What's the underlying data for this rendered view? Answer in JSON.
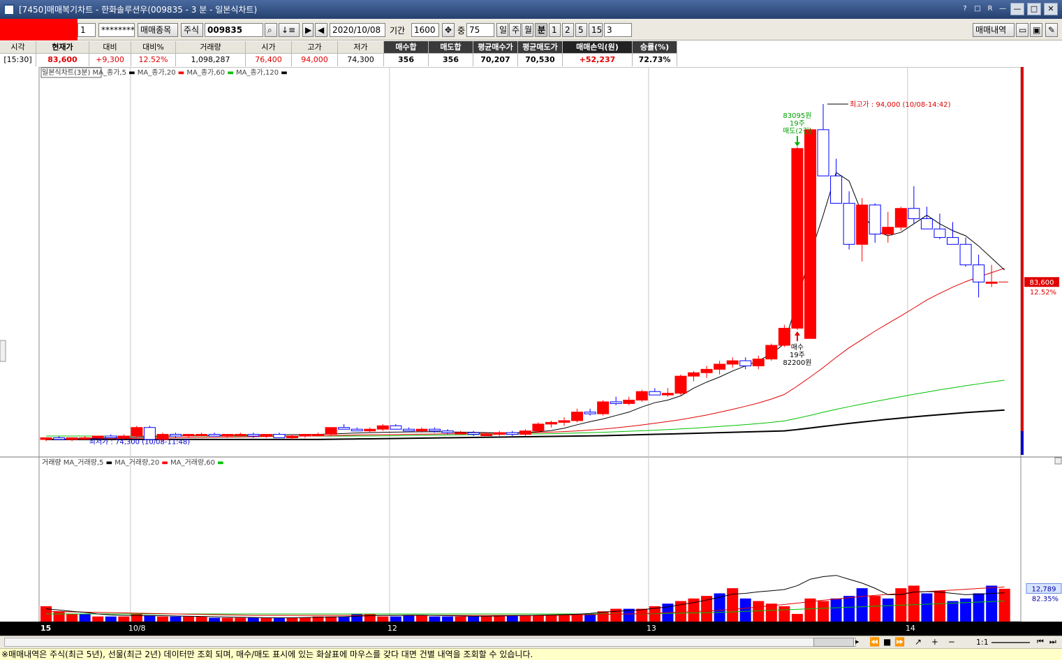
{
  "window": {
    "title": "[7450]매매복기차트 - 한화솔루션우(009835 - 3 분 - 일본식차트)",
    "right_icons": [
      "?",
      "□",
      "R",
      "—",
      "—",
      "□",
      "✕"
    ]
  },
  "toolbar": {
    "account_no": "1",
    "password": "********",
    "trade_item_btn": "매매종목",
    "market": "주식",
    "code": "009835",
    "date": "2020/10/08",
    "period_label": "기간",
    "period_value": "1600",
    "middle_label": "중",
    "middle_value": "75",
    "units": [
      "일",
      "주",
      "월",
      "분",
      "1",
      "2",
      "5",
      "15"
    ],
    "interval": "3",
    "trade_history_btn": "매매내역"
  },
  "info": {
    "headers": [
      "시각",
      "현재가",
      "대비",
      "대비%",
      "거래량",
      "시가",
      "고가",
      "저가",
      "매수합",
      "매도합",
      "평균매수가",
      "평균매도가",
      "매매손익(원)",
      "승률(%)"
    ],
    "values": [
      "[15:30]",
      "83,600",
      "+9,300",
      "12.52%",
      "1,098,287",
      "76,400",
      "94,000",
      "74,300",
      "356",
      "356",
      "70,207",
      "70,530",
      "+52,237",
      "72.73%"
    ]
  },
  "price_legend": {
    "name": "일본식차트(3분)",
    "items": [
      {
        "label": "MA_종가,5",
        "color": "#000000"
      },
      {
        "label": "MA_종가,20",
        "color": "#ff0000"
      },
      {
        "label": "MA_종가,60",
        "color": "#00c000"
      },
      {
        "label": "MA_종가,120",
        "color": "#000000"
      }
    ]
  },
  "volume_legend": {
    "name": "거래량",
    "items": [
      {
        "label": "MA_거래량,5",
        "color": "#000000"
      },
      {
        "label": "MA_거래량,20",
        "color": "#ff0000"
      },
      {
        "label": "MA_거래량,60",
        "color": "#00c000"
      }
    ]
  },
  "annotations": {
    "high": "최고가 : 94,000 (10/08-14:42)",
    "low": "최저가 : 74,300 (10/08-11:48)",
    "sell_lines": [
      "83095원",
      "19주",
      "매도(2건)"
    ],
    "buy_lines": [
      "매수",
      "19주",
      "82200원"
    ],
    "price_tag": "83,600",
    "price_pct": "12.52%",
    "vol_tag": "12,789",
    "vol_pct": "82.35%"
  },
  "x_labels": [
    "10/8",
    "12",
    "13",
    "14",
    "15"
  ],
  "status": "※매매내역은 주식(최근 5년), 선물(최근 2년) 데이터만 조회 되며, 매수/매도 표시에 있는 화살표에 마우스를 갖다 대면 건별 내역을 조회할 수 있습니다.",
  "scroll": {
    "zoom_label": "1:1"
  },
  "chart_data": {
    "type": "candlestick",
    "colors": {
      "up": "#ff0000",
      "down": "#0000ff"
    },
    "ylim": [
      73500,
      96000
    ],
    "candles": [
      {
        "o": 74400,
        "h": 74500,
        "l": 74300,
        "c": 74500
      },
      {
        "o": 74500,
        "h": 74600,
        "l": 74400,
        "c": 74400
      },
      {
        "o": 74400,
        "h": 74500,
        "l": 74300,
        "c": 74500
      },
      {
        "o": 74500,
        "h": 74600,
        "l": 74400,
        "c": 74500
      },
      {
        "o": 74500,
        "h": 74600,
        "l": 74400,
        "c": 74600
      },
      {
        "o": 74600,
        "h": 74700,
        "l": 74500,
        "c": 74500
      },
      {
        "o": 74500,
        "h": 74700,
        "l": 74400,
        "c": 74600
      },
      {
        "o": 74600,
        "h": 75200,
        "l": 74500,
        "c": 75100
      },
      {
        "o": 75100,
        "h": 75200,
        "l": 74400,
        "c": 74400
      },
      {
        "o": 74400,
        "h": 74800,
        "l": 74300,
        "c": 74700
      },
      {
        "o": 74700,
        "h": 74800,
        "l": 74500,
        "c": 74600
      },
      {
        "o": 74600,
        "h": 74700,
        "l": 74500,
        "c": 74700
      },
      {
        "o": 74700,
        "h": 74800,
        "l": 74600,
        "c": 74700
      },
      {
        "o": 74700,
        "h": 74800,
        "l": 74600,
        "c": 74600
      },
      {
        "o": 74600,
        "h": 74700,
        "l": 74500,
        "c": 74700
      },
      {
        "o": 74700,
        "h": 74800,
        "l": 74600,
        "c": 74700
      },
      {
        "o": 74700,
        "h": 74800,
        "l": 74500,
        "c": 74600
      },
      {
        "o": 74600,
        "h": 74700,
        "l": 74500,
        "c": 74700
      },
      {
        "o": 74700,
        "h": 74800,
        "l": 74500,
        "c": 74500
      },
      {
        "o": 74500,
        "h": 74700,
        "l": 74400,
        "c": 74600
      },
      {
        "o": 74600,
        "h": 74700,
        "l": 74500,
        "c": 74700
      },
      {
        "o": 74700,
        "h": 74800,
        "l": 74600,
        "c": 74700
      },
      {
        "o": 74700,
        "h": 74800,
        "l": 74600,
        "c": 75100
      },
      {
        "o": 75100,
        "h": 75300,
        "l": 75000,
        "c": 75000
      },
      {
        "o": 75000,
        "h": 75100,
        "l": 74900,
        "c": 74900
      },
      {
        "o": 74900,
        "h": 75100,
        "l": 74800,
        "c": 75000
      },
      {
        "o": 75000,
        "h": 75300,
        "l": 74900,
        "c": 75200
      },
      {
        "o": 75200,
        "h": 75300,
        "l": 75000,
        "c": 75000
      },
      {
        "o": 75000,
        "h": 75100,
        "l": 74900,
        "c": 74900
      },
      {
        "o": 74900,
        "h": 75100,
        "l": 74800,
        "c": 75000
      },
      {
        "o": 75000,
        "h": 75100,
        "l": 74800,
        "c": 74900
      },
      {
        "o": 74900,
        "h": 75000,
        "l": 74700,
        "c": 74800
      },
      {
        "o": 74800,
        "h": 74900,
        "l": 74700,
        "c": 74800
      },
      {
        "o": 74800,
        "h": 74900,
        "l": 74600,
        "c": 74700
      },
      {
        "o": 74700,
        "h": 74800,
        "l": 74600,
        "c": 74700
      },
      {
        "o": 74700,
        "h": 74900,
        "l": 74600,
        "c": 74800
      },
      {
        "o": 74800,
        "h": 74900,
        "l": 74600,
        "c": 74700
      },
      {
        "o": 74700,
        "h": 75000,
        "l": 74600,
        "c": 74900
      },
      {
        "o": 74900,
        "h": 75400,
        "l": 74800,
        "c": 75300
      },
      {
        "o": 75300,
        "h": 75500,
        "l": 75100,
        "c": 75400
      },
      {
        "o": 75400,
        "h": 75700,
        "l": 75200,
        "c": 75500
      },
      {
        "o": 75500,
        "h": 76200,
        "l": 75400,
        "c": 76000
      },
      {
        "o": 76000,
        "h": 76200,
        "l": 75800,
        "c": 75900
      },
      {
        "o": 75900,
        "h": 76700,
        "l": 75800,
        "c": 76600
      },
      {
        "o": 76600,
        "h": 76900,
        "l": 76400,
        "c": 76500
      },
      {
        "o": 76500,
        "h": 76900,
        "l": 76400,
        "c": 76700
      },
      {
        "o": 76700,
        "h": 77300,
        "l": 76600,
        "c": 77200
      },
      {
        "o": 77200,
        "h": 77400,
        "l": 77000,
        "c": 77000
      },
      {
        "o": 77000,
        "h": 77400,
        "l": 76900,
        "c": 77100
      },
      {
        "o": 77100,
        "h": 78200,
        "l": 77000,
        "c": 78100
      },
      {
        "o": 78100,
        "h": 78400,
        "l": 77800,
        "c": 78300
      },
      {
        "o": 78300,
        "h": 78700,
        "l": 78000,
        "c": 78500
      },
      {
        "o": 78500,
        "h": 79000,
        "l": 78200,
        "c": 78800
      },
      {
        "o": 78800,
        "h": 79200,
        "l": 78600,
        "c": 79000
      },
      {
        "o": 79000,
        "h": 79200,
        "l": 78500,
        "c": 78700
      },
      {
        "o": 78700,
        "h": 79300,
        "l": 78500,
        "c": 79100
      },
      {
        "o": 79100,
        "h": 80000,
        "l": 79000,
        "c": 79900
      },
      {
        "o": 79900,
        "h": 81100,
        "l": 79800,
        "c": 80900
      },
      {
        "o": 80900,
        "h": 91500,
        "l": 80800,
        "c": 91400
      },
      {
        "o": 80300,
        "h": 92600,
        "l": 80300,
        "c": 92500
      },
      {
        "o": 92500,
        "h": 94000,
        "l": 89800,
        "c": 89800
      },
      {
        "o": 89800,
        "h": 90800,
        "l": 88300,
        "c": 88200
      },
      {
        "o": 88200,
        "h": 88900,
        "l": 85500,
        "c": 85800
      },
      {
        "o": 85800,
        "h": 88500,
        "l": 84800,
        "c": 88100
      },
      {
        "o": 88100,
        "h": 88200,
        "l": 85900,
        "c": 86400
      },
      {
        "o": 86400,
        "h": 87700,
        "l": 85900,
        "c": 86800
      },
      {
        "o": 86800,
        "h": 88000,
        "l": 86600,
        "c": 87900
      },
      {
        "o": 87900,
        "h": 89200,
        "l": 87000,
        "c": 87300
      },
      {
        "o": 87300,
        "h": 88000,
        "l": 86700,
        "c": 86700
      },
      {
        "o": 86700,
        "h": 87600,
        "l": 86100,
        "c": 86200
      },
      {
        "o": 86200,
        "h": 87100,
        "l": 85800,
        "c": 85800
      },
      {
        "o": 85800,
        "h": 86200,
        "l": 84500,
        "c": 84600
      },
      {
        "o": 84600,
        "h": 85200,
        "l": 82700,
        "c": 83600
      },
      {
        "o": 83600,
        "h": 84600,
        "l": 83300,
        "c": 83600
      }
    ],
    "ma5": [
      74400,
      74420,
      74440,
      74460,
      74480,
      74500,
      74520,
      74540,
      74560,
      74580,
      74600,
      74610,
      74620,
      74630,
      74640,
      74650,
      74660,
      74670,
      74680,
      74680,
      74690,
      74700,
      74720,
      74750,
      74780,
      74800,
      74820,
      74830,
      74840,
      74850,
      74850,
      74840,
      74830,
      74820,
      74800,
      74780,
      74790,
      74810,
      74850,
      74920,
      75060,
      75260,
      75440,
      75600,
      75800,
      76000,
      76300,
      76550,
      76700,
      76950,
      77400,
      77750,
      78050,
      78400,
      78700,
      79000,
      79400,
      80000,
      82500,
      85200,
      87500,
      90000,
      89500,
      87600,
      86600,
      86300,
      86500,
      87000,
      87500,
      87000,
      86600,
      86300,
      85700,
      85000,
      84300
    ],
    "ma20": [
      74400,
      74410,
      74420,
      74430,
      74440,
      74450,
      74460,
      74470,
      74480,
      74490,
      74500,
      74510,
      74520,
      74530,
      74540,
      74550,
      74560,
      74570,
      74580,
      74590,
      74600,
      74610,
      74620,
      74640,
      74660,
      74670,
      74680,
      74690,
      74700,
      74710,
      74720,
      74730,
      74740,
      74750,
      74760,
      74770,
      74780,
      74790,
      74810,
      74830,
      74860,
      74900,
      74950,
      75010,
      75080,
      75160,
      75250,
      75350,
      75450,
      75560,
      75690,
      75830,
      75990,
      76160,
      76340,
      76530,
      76760,
      77030,
      77520,
      78050,
      78600,
      79200,
      79760,
      80240,
      80730,
      81180,
      81620,
      82080,
      82550,
      82940,
      83300,
      83620,
      83900,
      84150,
      84400
    ],
    "ma60": [
      74600,
      74600,
      74600,
      74600,
      74600,
      74600,
      74600,
      74600,
      74600,
      74600,
      74600,
      74600,
      74600,
      74600,
      74600,
      74600,
      74600,
      74600,
      74600,
      74600,
      74600,
      74600,
      74600,
      74600,
      74600,
      74600,
      74610,
      74620,
      74630,
      74640,
      74650,
      74660,
      74670,
      74680,
      74690,
      74700,
      74710,
      74720,
      74730,
      74740,
      74760,
      74780,
      74800,
      74820,
      74850,
      74880,
      74910,
      74940,
      74980,
      75020,
      75060,
      75110,
      75160,
      75210,
      75270,
      75330,
      75400,
      75480,
      75640,
      75810,
      75990,
      76160,
      76320,
      76470,
      76620,
      76760,
      76900,
      77040,
      77170,
      77300,
      77420,
      77540,
      77650,
      77760,
      77860
    ],
    "ma120": [
      74400,
      74400,
      74400,
      74400,
      74400,
      74400,
      74400,
      74400,
      74400,
      74400,
      74400,
      74400,
      74400,
      74400,
      74400,
      74400,
      74400,
      74400,
      74400,
      74400,
      74400,
      74400,
      74410,
      74420,
      74430,
      74440,
      74450,
      74460,
      74470,
      74480,
      74490,
      74500,
      74510,
      74520,
      74530,
      74540,
      74550,
      74560,
      74570,
      74580,
      74590,
      74600,
      74610,
      74620,
      74640,
      74660,
      74680,
      74700,
      74720,
      74740,
      74760,
      74780,
      74800,
      74820,
      74840,
      74860,
      74880,
      74900,
      74980,
      75070,
      75160,
      75250,
      75340,
      75420,
      75500,
      75580,
      75650,
      75720,
      75790,
      75850,
      75910,
      75970,
      76020,
      76070,
      76120
    ],
    "volume": [
      6000,
      4000,
      3000,
      3000,
      2000,
      2000,
      2000,
      3000,
      2500,
      2000,
      2000,
      2000,
      2000,
      1500,
      1500,
      1500,
      1500,
      1500,
      1500,
      1500,
      1500,
      2000,
      2000,
      2000,
      3000,
      3000,
      2000,
      2000,
      2500,
      2500,
      2000,
      2000,
      2000,
      2000,
      2000,
      2500,
      2500,
      2500,
      2500,
      2500,
      2500,
      3000,
      3000,
      4000,
      5000,
      5000,
      5000,
      6000,
      7000,
      8000,
      9000,
      10000,
      11000,
      13000,
      9000,
      8000,
      7000,
      6000,
      3000,
      9000,
      8000,
      9000,
      10000,
      13000,
      10000,
      9000,
      13000,
      14000,
      11000,
      12000,
      8000,
      9000,
      11000,
      14000,
      12789
    ],
    "vol_up": [
      1,
      1,
      1,
      0,
      1,
      0,
      1,
      1,
      0,
      1,
      0,
      1,
      1,
      0,
      1,
      1,
      0,
      1,
      0,
      1,
      1,
      1,
      1,
      0,
      0,
      1,
      1,
      0,
      0,
      1,
      0,
      0,
      1,
      0,
      1,
      1,
      0,
      1,
      1,
      1,
      1,
      1,
      0,
      1,
      1,
      0,
      1,
      1,
      0,
      1,
      1,
      1,
      0,
      1,
      0,
      1,
      1,
      1,
      1,
      1,
      1,
      0,
      0,
      0,
      1,
      0,
      1,
      1,
      0,
      1,
      0,
      0,
      0,
      0,
      1
    ],
    "vol_ma5": [
      5000,
      4500,
      4000,
      3600,
      3000,
      2600,
      2400,
      2400,
      2300,
      2300,
      2200,
      2100,
      2000,
      1900,
      1800,
      1700,
      1600,
      1500,
      1500,
      1500,
      1600,
      1700,
      1800,
      1900,
      2100,
      2300,
      2400,
      2400,
      2500,
      2500,
      2400,
      2300,
      2200,
      2100,
      2100,
      2200,
      2300,
      2400,
      2500,
      2600,
      2700,
      2900,
      3200,
      3700,
      4000,
      4300,
      4600,
      5200,
      5700,
      6600,
      7400,
      8400,
      9500,
      10700,
      11000,
      11600,
      12000,
      12500,
      14000,
      16500,
      17500,
      18000,
      16500,
      15000,
      13000,
      10500,
      10500,
      11500,
      11700,
      11500,
      11000,
      10500,
      10700,
      11000,
      11200
    ],
    "vol_ma20": [
      4000,
      3900,
      3800,
      3700,
      3600,
      3500,
      3400,
      3300,
      3200,
      3100,
      3000,
      2900,
      2800,
      2700,
      2600,
      2500,
      2400,
      2400,
      2400,
      2400,
      2400,
      2400,
      2400,
      2400,
      2400,
      2400,
      2400,
      2400,
      2400,
      2400,
      2400,
      2400,
      2400,
      2400,
      2400,
      2400,
      2400,
      2400,
      2400,
      2400,
      2500,
      2600,
      2700,
      2800,
      2900,
      3000,
      3100,
      3300,
      3500,
      3700,
      3900,
      4100,
      4400,
      4800,
      5200,
      5700,
      6200,
      6700,
      7200,
      7800,
      8300,
      8800,
      9300,
      9800,
      10200,
      10600,
      11000,
      11400,
      11700,
      12000,
      12300,
      12600,
      12900,
      13200,
      13500
    ],
    "vol_ma60": [
      3000,
      3000,
      3000,
      3000,
      3000,
      3000,
      3000,
      3000,
      3000,
      3000,
      3000,
      3000,
      3000,
      3000,
      3000,
      3000,
      3000,
      3000,
      3000,
      3000,
      3000,
      3000,
      3000,
      3000,
      3000,
      3000,
      3000,
      3000,
      3000,
      3000,
      3000,
      3000,
      3000,
      3000,
      3000,
      3000,
      3000,
      3000,
      3000,
      3000,
      3000,
      3000,
      3000,
      3000,
      3000,
      3000,
      3000,
      3100,
      3200,
      3300,
      3400,
      3500,
      3600,
      3800,
      4000,
      4200,
      4400,
      4600,
      4800,
      5000,
      5200,
      5400,
      5600,
      5800,
      6000,
      6200,
      6400,
      6600,
      6800,
      7000,
      7200,
      7400,
      7600,
      7800,
      8000
    ],
    "vol_ylim": [
      0,
      60000
    ],
    "x_label_candle_index": {
      "10/8": 0,
      "12": 7,
      "13": 27,
      "14": 47,
      "15": 67
    }
  }
}
